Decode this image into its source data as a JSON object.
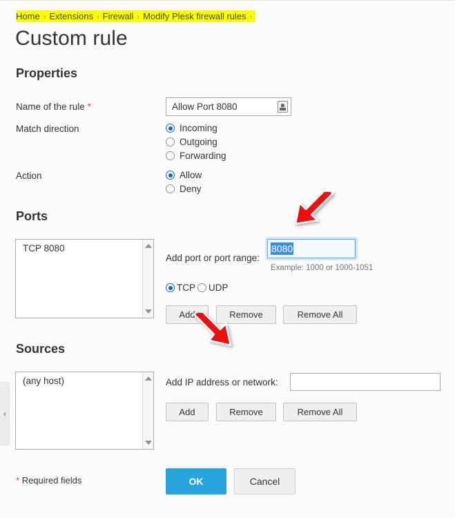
{
  "breadcrumb": {
    "items": [
      "Home",
      "Extensions",
      "Firewall",
      "Modify Plesk firewall rules"
    ],
    "separator": "›",
    "trailing_separator": "›",
    "highlight_color": "#ffff00",
    "link_color": "#3d5408"
  },
  "page": {
    "title": "Custom rule"
  },
  "sidebar": {
    "collapse_icon": "‹"
  },
  "properties": {
    "title": "Properties",
    "name_label": "Name of the rule",
    "required_marker": "*",
    "name_value": "Allow Port 8080",
    "match_direction_label": "Match direction",
    "match_direction_options": [
      "Incoming",
      "Outgoing",
      "Forwarding"
    ],
    "match_direction_selected": "Incoming",
    "action_label": "Action",
    "action_options": [
      "Allow",
      "Deny"
    ],
    "action_selected": "Allow"
  },
  "ports": {
    "title": "Ports",
    "list_items": [
      "TCP 8080"
    ],
    "add_label": "Add port or port range:",
    "input_value": "8080",
    "input_selected": true,
    "hint": "Example: 1000 or 1000-1051",
    "protocol_options": [
      "TCP",
      "UDP"
    ],
    "protocol_selected": "TCP",
    "buttons": {
      "add": "Add",
      "remove": "Remove",
      "remove_all": "Remove All"
    }
  },
  "sources": {
    "title": "Sources",
    "list_items": [
      "(any host)"
    ],
    "add_label": "Add IP address or network:",
    "input_value": "",
    "buttons": {
      "add": "Add",
      "remove": "Remove",
      "remove_all": "Remove All"
    }
  },
  "footer": {
    "required_note_star": "*",
    "required_note": "Required fields",
    "ok_label": "OK",
    "cancel_label": "Cancel",
    "ok_color": "#29a3dc"
  },
  "annotations": {
    "arrow_color": "#ee1111",
    "arrow_1_target": "port-input",
    "arrow_2_target": "ports-add-button"
  }
}
